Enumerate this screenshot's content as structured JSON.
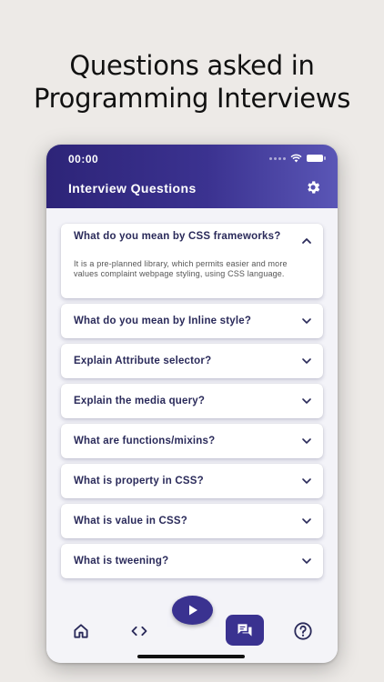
{
  "headline": {
    "line1": "Questions asked in",
    "line2": "Programming Interviews"
  },
  "status_bar": {
    "time": "00:00"
  },
  "app_bar": {
    "title": "Interview Questions",
    "settings_icon": "gear-icon"
  },
  "questions": [
    {
      "question": "What do you mean by CSS frameworks?",
      "answer": "It is a pre-planned library, which permits easier and more values complaint webpage styling, using CSS language.",
      "expanded": true
    },
    {
      "question": "What do you mean by Inline style?",
      "expanded": false
    },
    {
      "question": "Explain Attribute selector?",
      "expanded": false
    },
    {
      "question": "Explain the media query?",
      "expanded": false
    },
    {
      "question": "What are functions/mixins?",
      "expanded": false
    },
    {
      "question": "What is property in CSS?",
      "expanded": false
    },
    {
      "question": "What is value in CSS?",
      "expanded": false
    },
    {
      "question": "What is tweening?",
      "expanded": false
    }
  ],
  "bottom_nav": {
    "items": [
      "home-icon",
      "code-icon",
      "play-icon",
      "chat-icon",
      "help-icon"
    ],
    "active": "chat-icon"
  },
  "colors": {
    "primary": "#3a3290",
    "appbar_start": "#2d2478",
    "appbar_end": "#5a56b6",
    "question_text": "#2a2a5a",
    "background": "#edeae7"
  }
}
